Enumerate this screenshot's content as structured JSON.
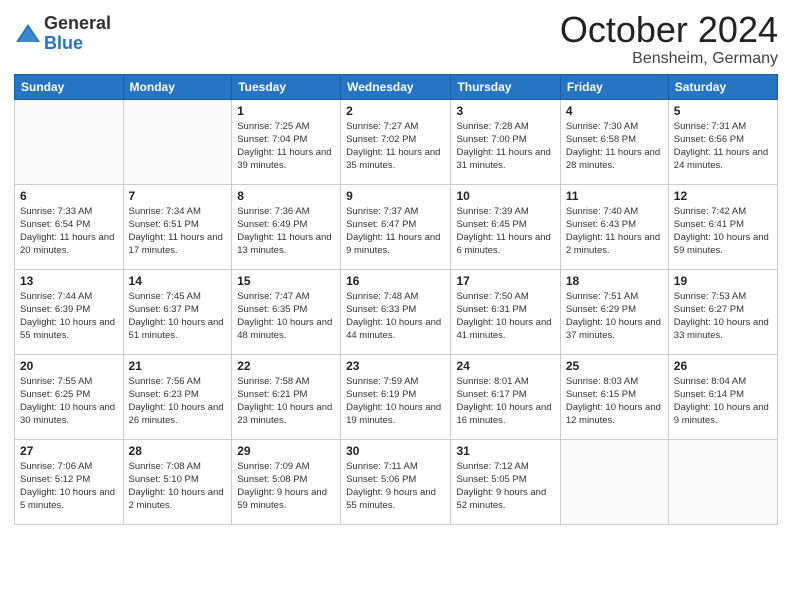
{
  "header": {
    "logo_general": "General",
    "logo_blue": "Blue",
    "month_title": "October 2024",
    "location": "Bensheim, Germany"
  },
  "weekdays": [
    "Sunday",
    "Monday",
    "Tuesday",
    "Wednesday",
    "Thursday",
    "Friday",
    "Saturday"
  ],
  "weeks": [
    [
      {
        "day": "",
        "info": ""
      },
      {
        "day": "",
        "info": ""
      },
      {
        "day": "1",
        "info": "Sunrise: 7:25 AM\nSunset: 7:04 PM\nDaylight: 11 hours\nand 39 minutes."
      },
      {
        "day": "2",
        "info": "Sunrise: 7:27 AM\nSunset: 7:02 PM\nDaylight: 11 hours\nand 35 minutes."
      },
      {
        "day": "3",
        "info": "Sunrise: 7:28 AM\nSunset: 7:00 PM\nDaylight: 11 hours\nand 31 minutes."
      },
      {
        "day": "4",
        "info": "Sunrise: 7:30 AM\nSunset: 6:58 PM\nDaylight: 11 hours\nand 28 minutes."
      },
      {
        "day": "5",
        "info": "Sunrise: 7:31 AM\nSunset: 6:56 PM\nDaylight: 11 hours\nand 24 minutes."
      }
    ],
    [
      {
        "day": "6",
        "info": "Sunrise: 7:33 AM\nSunset: 6:54 PM\nDaylight: 11 hours\nand 20 minutes."
      },
      {
        "day": "7",
        "info": "Sunrise: 7:34 AM\nSunset: 6:51 PM\nDaylight: 11 hours\nand 17 minutes."
      },
      {
        "day": "8",
        "info": "Sunrise: 7:36 AM\nSunset: 6:49 PM\nDaylight: 11 hours\nand 13 minutes."
      },
      {
        "day": "9",
        "info": "Sunrise: 7:37 AM\nSunset: 6:47 PM\nDaylight: 11 hours\nand 9 minutes."
      },
      {
        "day": "10",
        "info": "Sunrise: 7:39 AM\nSunset: 6:45 PM\nDaylight: 11 hours\nand 6 minutes."
      },
      {
        "day": "11",
        "info": "Sunrise: 7:40 AM\nSunset: 6:43 PM\nDaylight: 11 hours\nand 2 minutes."
      },
      {
        "day": "12",
        "info": "Sunrise: 7:42 AM\nSunset: 6:41 PM\nDaylight: 10 hours\nand 59 minutes."
      }
    ],
    [
      {
        "day": "13",
        "info": "Sunrise: 7:44 AM\nSunset: 6:39 PM\nDaylight: 10 hours\nand 55 minutes."
      },
      {
        "day": "14",
        "info": "Sunrise: 7:45 AM\nSunset: 6:37 PM\nDaylight: 10 hours\nand 51 minutes."
      },
      {
        "day": "15",
        "info": "Sunrise: 7:47 AM\nSunset: 6:35 PM\nDaylight: 10 hours\nand 48 minutes."
      },
      {
        "day": "16",
        "info": "Sunrise: 7:48 AM\nSunset: 6:33 PM\nDaylight: 10 hours\nand 44 minutes."
      },
      {
        "day": "17",
        "info": "Sunrise: 7:50 AM\nSunset: 6:31 PM\nDaylight: 10 hours\nand 41 minutes."
      },
      {
        "day": "18",
        "info": "Sunrise: 7:51 AM\nSunset: 6:29 PM\nDaylight: 10 hours\nand 37 minutes."
      },
      {
        "day": "19",
        "info": "Sunrise: 7:53 AM\nSunset: 6:27 PM\nDaylight: 10 hours\nand 33 minutes."
      }
    ],
    [
      {
        "day": "20",
        "info": "Sunrise: 7:55 AM\nSunset: 6:25 PM\nDaylight: 10 hours\nand 30 minutes."
      },
      {
        "day": "21",
        "info": "Sunrise: 7:56 AM\nSunset: 6:23 PM\nDaylight: 10 hours\nand 26 minutes."
      },
      {
        "day": "22",
        "info": "Sunrise: 7:58 AM\nSunset: 6:21 PM\nDaylight: 10 hours\nand 23 minutes."
      },
      {
        "day": "23",
        "info": "Sunrise: 7:59 AM\nSunset: 6:19 PM\nDaylight: 10 hours\nand 19 minutes."
      },
      {
        "day": "24",
        "info": "Sunrise: 8:01 AM\nSunset: 6:17 PM\nDaylight: 10 hours\nand 16 minutes."
      },
      {
        "day": "25",
        "info": "Sunrise: 8:03 AM\nSunset: 6:15 PM\nDaylight: 10 hours\nand 12 minutes."
      },
      {
        "day": "26",
        "info": "Sunrise: 8:04 AM\nSunset: 6:14 PM\nDaylight: 10 hours\nand 9 minutes."
      }
    ],
    [
      {
        "day": "27",
        "info": "Sunrise: 7:06 AM\nSunset: 5:12 PM\nDaylight: 10 hours\nand 5 minutes."
      },
      {
        "day": "28",
        "info": "Sunrise: 7:08 AM\nSunset: 5:10 PM\nDaylight: 10 hours\nand 2 minutes."
      },
      {
        "day": "29",
        "info": "Sunrise: 7:09 AM\nSunset: 5:08 PM\nDaylight: 9 hours\nand 59 minutes."
      },
      {
        "day": "30",
        "info": "Sunrise: 7:11 AM\nSunset: 5:06 PM\nDaylight: 9 hours\nand 55 minutes."
      },
      {
        "day": "31",
        "info": "Sunrise: 7:12 AM\nSunset: 5:05 PM\nDaylight: 9 hours\nand 52 minutes."
      },
      {
        "day": "",
        "info": ""
      },
      {
        "day": "",
        "info": ""
      }
    ]
  ]
}
